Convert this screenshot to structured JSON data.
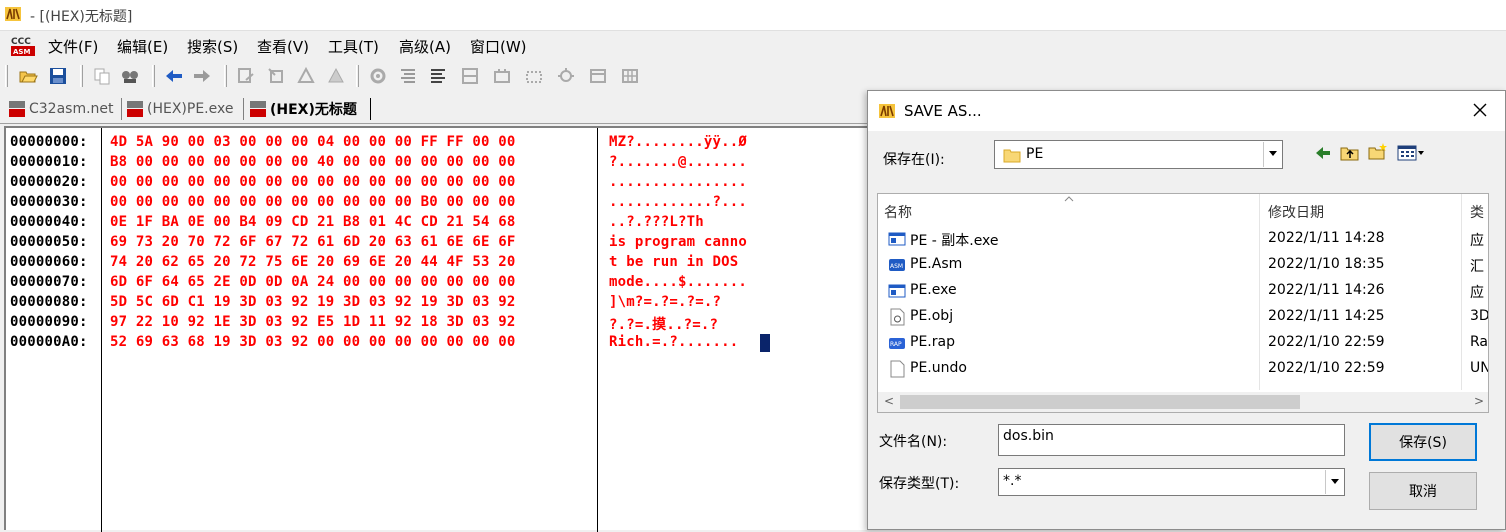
{
  "window": {
    "title": "- [(HEX)无标题]"
  },
  "menu": [
    "文件(F)",
    "编辑(E)",
    "搜索(S)",
    "查看(V)",
    "工具(T)",
    "高级(A)",
    "窗口(W)"
  ],
  "toolbar": {
    "icons": [
      "open-icon",
      "save-icon",
      "copy-icon",
      "find-icon",
      "back-arrow-icon",
      "forward-arrow-icon",
      "tool-icon",
      "tool-icon",
      "tool-icon",
      "tool-icon",
      "gear-icon",
      "align-icon",
      "align-icon",
      "grid-icon",
      "grid-icon",
      "grid-icon",
      "bug-icon",
      "window-icon",
      "table-icon"
    ]
  },
  "tabs": [
    {
      "label": "C32asm.net",
      "active": false
    },
    {
      "label": "(HEX)PE.exe",
      "active": false
    },
    {
      "label": "(HEX)无标题",
      "active": true
    }
  ],
  "hex": {
    "rows": [
      {
        "addr": "00000000:",
        "bytes": "4D 5A 90 00 03 00 00 00 04 00 00 00 FF FF 00 00",
        "ascii": "MZ?........ÿÿ..Ø"
      },
      {
        "addr": "00000010:",
        "bytes": "B8 00 00 00 00 00 00 00 40 00 00 00 00 00 00 00",
        "ascii": "?.......@......."
      },
      {
        "addr": "00000020:",
        "bytes": "00 00 00 00 00 00 00 00 00 00 00 00 00 00 00 00",
        "ascii": "................"
      },
      {
        "addr": "00000030:",
        "bytes": "00 00 00 00 00 00 00 00 00 00 00 00 B0 00 00 00",
        "ascii": "............?..."
      },
      {
        "addr": "00000040:",
        "bytes": "0E 1F BA 0E 00 B4 09 CD 21 B8 01 4C CD 21 54 68",
        "ascii": "..?.???L?Th"
      },
      {
        "addr": "00000050:",
        "bytes": "69 73 20 70 72 6F 67 72 61 6D 20 63 61 6E 6E 6F",
        "ascii": "is program canno"
      },
      {
        "addr": "00000060:",
        "bytes": "74 20 62 65 20 72 75 6E 20 69 6E 20 44 4F 53 20",
        "ascii": "t be run in DOS "
      },
      {
        "addr": "00000070:",
        "bytes": "6D 6F 64 65 2E 0D 0D 0A 24 00 00 00 00 00 00 00",
        "ascii": "mode....$......."
      },
      {
        "addr": "00000080:",
        "bytes": "5D 5C 6D C1 19 3D 03 92 19 3D 03 92 19 3D 03 92",
        "ascii": "]\\m?=.?=.?=.?"
      },
      {
        "addr": "00000090:",
        "bytes": "97 22 10 92 1E 3D 03 92 E5 1D 11 92 18 3D 03 92",
        "ascii": "?.?=.摸..?=.?"
      },
      {
        "addr": "000000A0:",
        "bytes": "52 69 63 68 19 3D 03 92 00 00 00 00 00 00 00 00",
        "ascii": "Rich.=.?......."
      }
    ]
  },
  "dialog": {
    "title": "SAVE AS...",
    "save_in_label": "保存在(I):",
    "save_in_value": "PE",
    "columns": {
      "name": "名称",
      "date": "修改日期",
      "type": "类"
    },
    "files": [
      {
        "name": "PE - 副本.exe",
        "date": "2022/1/11 14:28",
        "type": "应",
        "icon": "exe-icon"
      },
      {
        "name": "PE.Asm",
        "date": "2022/1/10 18:35",
        "type": "汇",
        "icon": "asm-icon"
      },
      {
        "name": "PE.exe",
        "date": "2022/1/11 14:26",
        "type": "应",
        "icon": "exe-icon"
      },
      {
        "name": "PE.obj",
        "date": "2022/1/11 14:25",
        "type": "3D",
        "icon": "obj-icon"
      },
      {
        "name": "PE.rap",
        "date": "2022/1/10 22:59",
        "type": "Ra",
        "icon": "rap-icon"
      },
      {
        "name": "PE.undo",
        "date": "2022/1/10 22:59",
        "type": "UN",
        "icon": "file-icon"
      }
    ],
    "filename_label": "文件名(N):",
    "filename_value": "dos.bin",
    "filetype_label": "保存类型(T):",
    "filetype_value": "*.*",
    "save_button": "保存(S)",
    "cancel_button": "取消"
  }
}
